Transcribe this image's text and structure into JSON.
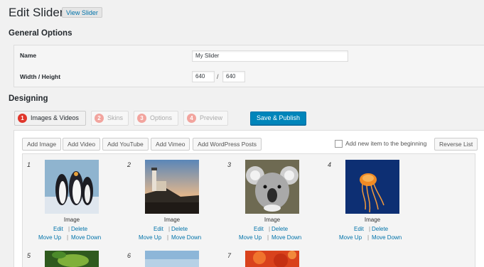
{
  "page": {
    "title": "Edit Slider",
    "view_button": "View Slider"
  },
  "general": {
    "heading": "General Options",
    "name_label": "Name",
    "name_value": "My Slider",
    "size_label": "Width / Height",
    "width": "640",
    "separator": "/",
    "height": "640"
  },
  "designing": {
    "heading": "Designing",
    "steps": [
      {
        "num": "1",
        "label": "Images & Videos"
      },
      {
        "num": "2",
        "label": "Skins"
      },
      {
        "num": "3",
        "label": "Options"
      },
      {
        "num": "4",
        "label": "Preview"
      }
    ],
    "publish": "Save & Publish"
  },
  "toolbar": {
    "buttons": [
      "Add Image",
      "Add Video",
      "Add YouTube",
      "Add Vimeo",
      "Add WordPress Posts"
    ],
    "checkbox_label": "Add new item to the beginning",
    "reverse": "Reverse List"
  },
  "items": [
    {
      "num": "1",
      "caption": "Image",
      "edit": "Edit",
      "delete": "Delete",
      "move_up": "Move Up",
      "move_down": "Move Down"
    },
    {
      "num": "2",
      "caption": "Image",
      "edit": "Edit",
      "delete": "Delete",
      "move_up": "Move Up",
      "move_down": "Move Down"
    },
    {
      "num": "3",
      "caption": "Image",
      "edit": "Edit",
      "delete": "Delete",
      "move_up": "Move Up",
      "move_down": "Move Down"
    },
    {
      "num": "4",
      "caption": "Image",
      "edit": "Edit",
      "delete": "Delete",
      "move_up": "Move Up",
      "move_down": "Move Down"
    },
    {
      "num": "5"
    },
    {
      "num": "6"
    },
    {
      "num": "7"
    }
  ],
  "link_separator": "|",
  "colors": {
    "primary_button": "#0085ba",
    "step_badge": "#e0362b",
    "link": "#0073aa"
  }
}
